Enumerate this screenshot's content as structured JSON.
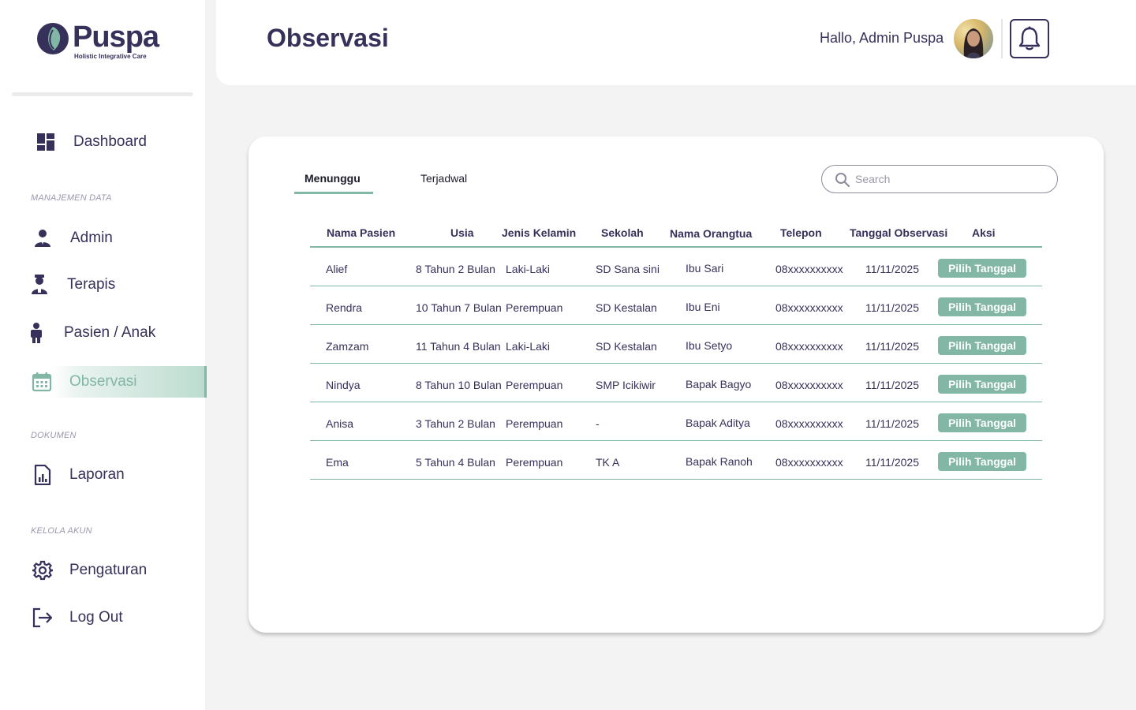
{
  "brand": {
    "name": "Puspa",
    "tagline": "Holistic Integrative Care"
  },
  "sidebar": {
    "dashboard": "Dashboard",
    "sections": {
      "data": "MANAJEMEN DATA",
      "docs": "DOKUMEN",
      "account": "KELOLA AKUN"
    },
    "items": {
      "admin": "Admin",
      "terapis": "Terapis",
      "pasien": "Pasien / Anak",
      "observasi": "Observasi",
      "laporan": "Laporan",
      "pengaturan": "Pengaturan",
      "logout": "Log Out"
    },
    "active": "observasi"
  },
  "header": {
    "title": "Observasi",
    "greeting": "Hallo, Admin Puspa"
  },
  "tabs": {
    "waiting": "Menunggu",
    "scheduled": "Terjadwal",
    "active": "waiting"
  },
  "search": {
    "placeholder": "Search",
    "value": ""
  },
  "table": {
    "headers": [
      "Nama Pasien",
      "Usia",
      "Jenis Kelamin",
      "Sekolah",
      "Nama Orangtua",
      "Telepon",
      "Tanggal Observasi",
      "Aksi"
    ],
    "action_label": "Pilih Tanggal",
    "rows": [
      {
        "nama": "Alief",
        "usia": "8 Tahun 2 Bulan",
        "jk": "Laki-Laki",
        "sekolah": "SD Sana sini",
        "ortu": "Ibu Sari",
        "telepon": "08xxxxxxxxxx",
        "tanggal": "11/11/2025"
      },
      {
        "nama": "Rendra",
        "usia": "10 Tahun 7 Bulan",
        "jk": "Perempuan",
        "sekolah": "SD Kestalan",
        "ortu": "Ibu Eni",
        "telepon": "08xxxxxxxxxx",
        "tanggal": "11/11/2025"
      },
      {
        "nama": "Zamzam",
        "usia": "11 Tahun 4 Bulan",
        "jk": "Laki-Laki",
        "sekolah": "SD Kestalan",
        "ortu": "Ibu Setyo",
        "telepon": "08xxxxxxxxxx",
        "tanggal": "11/11/2025"
      },
      {
        "nama": "Nindya",
        "usia": "8 Tahun 10 Bulan",
        "jk": "Perempuan",
        "sekolah": "SMP Icikiwir",
        "ortu": "Bapak Bagyo",
        "telepon": "08xxxxxxxxxx",
        "tanggal": "11/11/2025"
      },
      {
        "nama": "Anisa",
        "usia": "3 Tahun 2 Bulan",
        "jk": "Perempuan",
        "sekolah": "-",
        "ortu": "Bapak Aditya",
        "telepon": "08xxxxxxxxxx",
        "tanggal": "11/11/2025"
      },
      {
        "nama": "Ema",
        "usia": "5 Tahun 4 Bulan",
        "jk": "Perempuan",
        "sekolah": "TK A",
        "ortu": "Bapak Ranoh",
        "telepon": "08xxxxxxxxxx",
        "tanggal": "11/11/2025"
      }
    ]
  },
  "colors": {
    "primary": "#36315a",
    "accent": "#81b7a4",
    "background": "#f3f3f3"
  },
  "icons": {
    "dashboard": "dashboard-icon",
    "admin": "admin-user-icon",
    "terapis": "therapist-icon",
    "pasien": "child-icon",
    "observasi": "calendar-icon",
    "laporan": "report-file-icon",
    "pengaturan": "gear-icon",
    "logout": "logout-icon",
    "bell": "bell-icon",
    "search": "search-icon"
  }
}
